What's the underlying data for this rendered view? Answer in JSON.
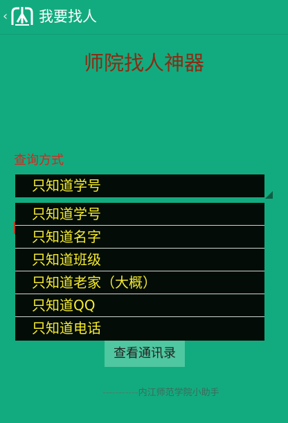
{
  "actionbar": {
    "back_glyph": "‹",
    "title": "我要找人",
    "logo_icon": "nei-logo-icon"
  },
  "page": {
    "heading": "师院找人神器",
    "query_label": "查询方式"
  },
  "spinner": {
    "selected": "只知道学号",
    "options": [
      "只知道学号",
      "只知道名字",
      "只知道班级",
      "只知道老家（大概）",
      "只知道QQ",
      "只知道电话"
    ]
  },
  "query_button": {
    "label": "查看通讯录"
  },
  "footer": {
    "dashes": "-----------",
    "text": "内江师范学院小助手"
  },
  "colors": {
    "background": "#12ab7f",
    "heading": "#8a2c13",
    "label": "#d8261e",
    "dropdown_bg": "#030c06",
    "dropdown_text": "#f5eb2f",
    "button_bg": "#4fc7a0"
  }
}
